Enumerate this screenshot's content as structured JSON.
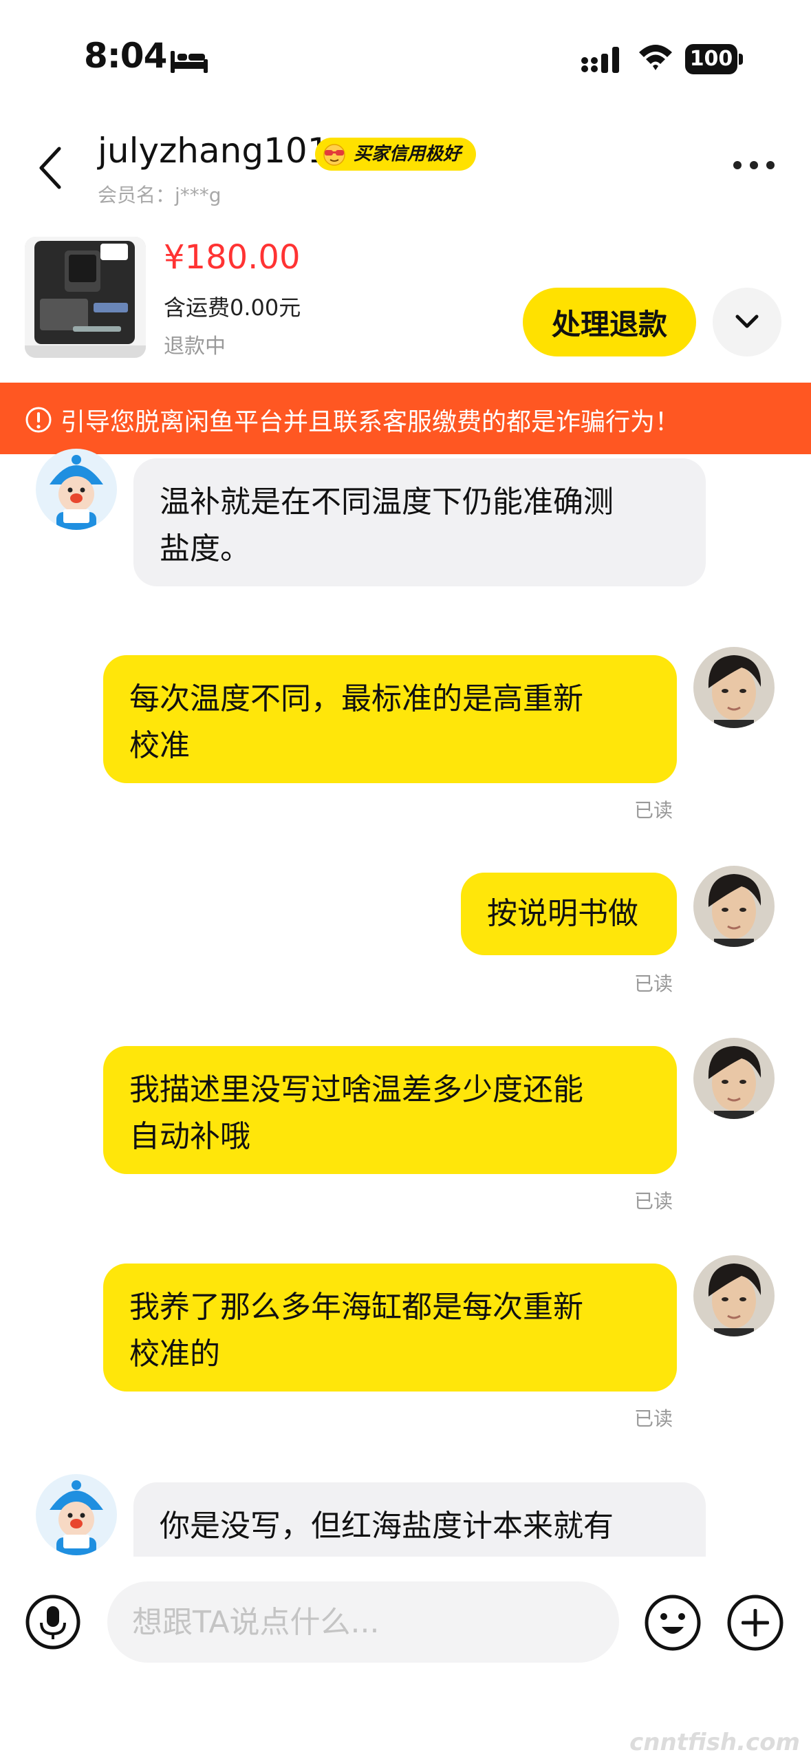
{
  "status_bar": {
    "time": "8:04",
    "battery": "100"
  },
  "header": {
    "username": "julyzhang101",
    "credit_badge": "买家信用极好",
    "member_label": "会员名：j***g"
  },
  "product": {
    "price": "¥180.00",
    "shipping": "含运费0.00元",
    "status": "退款中",
    "refund_button": "处理退款"
  },
  "warning": "引导您脱离闲鱼平台并且联系客服缴费的都是诈骗行为！",
  "messages": [
    {
      "side": "in",
      "text_lines": [
        "温补就是在不同温度下仍能准确测",
        "盐度。"
      ]
    },
    {
      "side": "out",
      "text_lines": [
        "每次温度不同，最标准的是高重新",
        "校准"
      ],
      "status": "已读"
    },
    {
      "side": "out",
      "text_lines": [
        "按说明书做"
      ],
      "status": "已读"
    },
    {
      "side": "out",
      "text_lines": [
        "我描述里没写过啥温差多少度还能",
        "自动补哦"
      ],
      "status": "已读"
    },
    {
      "side": "out",
      "text_lines": [
        "我养了那么多年海缸都是每次重新",
        "校准的"
      ],
      "status": "已读"
    },
    {
      "side": "in",
      "text_lines": [
        "你是没写，但红海盐度计本来就有"
      ]
    }
  ],
  "input": {
    "placeholder": "想跟TA说点什么..."
  },
  "watermark": "cnntfish.com",
  "colors": {
    "accent_yellow": "#ffe100",
    "warning_orange": "#ff5722",
    "price_red": "#ff3333"
  }
}
